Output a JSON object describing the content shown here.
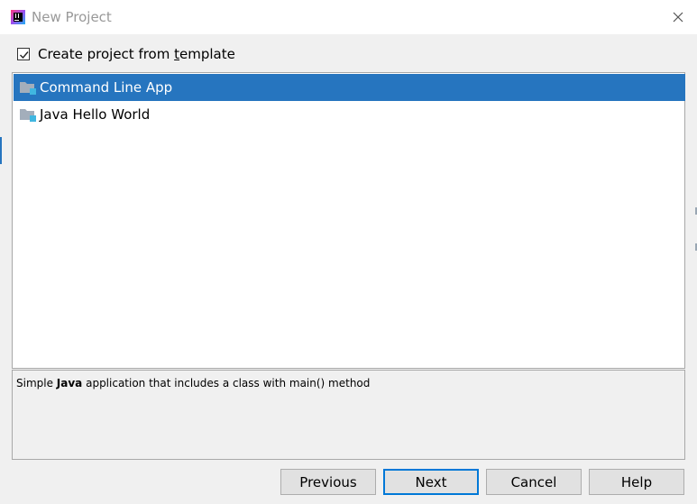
{
  "window": {
    "title": "New Project",
    "app_icon": "intellij-idea-icon",
    "close_icon": "close-icon"
  },
  "template_option": {
    "checked": true,
    "label_prefix": "Create project from ",
    "label_mnemonic": "t",
    "label_suffix": "emplate"
  },
  "templates": [
    {
      "label": "Command Line App",
      "icon": "folder-module-icon",
      "selected": true
    },
    {
      "label": "Java Hello World",
      "icon": "folder-module-icon",
      "selected": false
    }
  ],
  "description": {
    "prefix": "Simple ",
    "bold": "Java",
    "suffix": " application that includes a class with main() method"
  },
  "buttons": {
    "previous": "Previous",
    "next": "Next",
    "cancel": "Cancel",
    "help": "Help"
  },
  "colors": {
    "selection": "#2675bf",
    "default_button_border": "#0078d7"
  }
}
